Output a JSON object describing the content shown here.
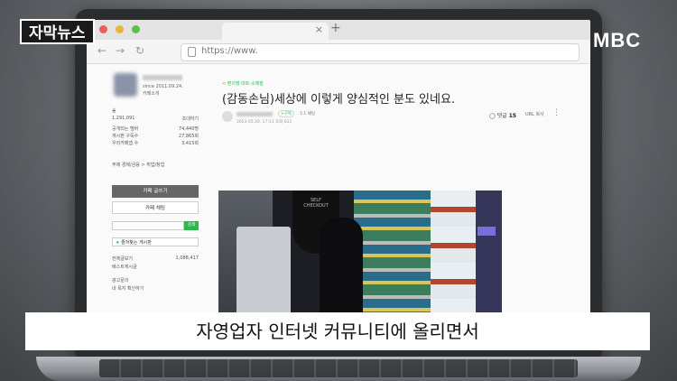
{
  "overlay": {
    "left_logo": "자막뉴스",
    "right_logo": "MBC",
    "caption": "자영업자 인터넷 커뮤니티에 올리면서"
  },
  "browser": {
    "url": "https://www.",
    "tab_close": "×",
    "tab_plus": "+",
    "nav_back": "←",
    "nav_forward": "→",
    "nav_reload": "↻"
  },
  "sidebar": {
    "since": "since 2011.09.24.",
    "intro": "카페소개",
    "level_label": "숲",
    "member_count": "1,291,091",
    "invite": "초대하기",
    "rows": [
      {
        "label": "공개되는 멤버",
        "value": "74,440명"
      },
      {
        "label": "게시판 구독수",
        "value": "27,865회"
      },
      {
        "label": "우리카페앱 수",
        "value": "3,415회"
      }
    ],
    "topic": "주제 경제/금융 > 취업/창업",
    "write_button": "카페 글쓰기",
    "chat_button": "카페 채팅",
    "search_button": "검색",
    "favorite": "즐겨찾는 게시판",
    "board_all": "전체글보기",
    "board_all_count": "1,088,417",
    "board_best": "베스트게시글",
    "board_notice": "광고문의",
    "board_mine": "내 목지 확인하기"
  },
  "post": {
    "category": "< 편의점·마트·소매점",
    "title": "(감동손님)세상에 이렇게 양심적인 분도 있네요.",
    "badge": "+구독",
    "level": "1:1 채팅",
    "date": "2023.05.20. 17:11  조회 621",
    "comment_label": "댓글",
    "comment_count": "15",
    "share": "URL 복사",
    "more": "⋮",
    "photo_sign": "SELF CHECKOUT"
  }
}
